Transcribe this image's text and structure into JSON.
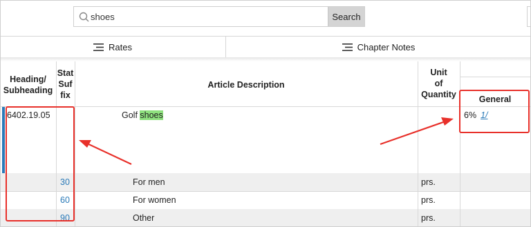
{
  "search": {
    "value": "shoes",
    "button_label": "Search"
  },
  "tabs": [
    {
      "label": "Rates",
      "icon": "menu-icon"
    },
    {
      "label": "Chapter Notes",
      "icon": "menu-icon"
    }
  ],
  "table": {
    "headers": {
      "heading_line1": "Heading/",
      "heading_line2": "Subheading",
      "stat_line1": "Stat",
      "stat_line2": "Suf",
      "stat_line3": "fix",
      "description": "Article Description",
      "unit_line1": "Unit",
      "unit_line2": "of",
      "unit_line3": "Quantity",
      "general": "General"
    },
    "rows": [
      {
        "heading": "6402.19.05",
        "suffix": "",
        "description_prefix": "Golf ",
        "description_highlight": "shoes",
        "unit": "",
        "general": "6%",
        "general_note": "1/"
      },
      {
        "heading": "",
        "suffix": "30",
        "description": "For men",
        "unit": "prs."
      },
      {
        "heading": "",
        "suffix": "60",
        "description": "For women",
        "unit": "prs."
      },
      {
        "heading": "",
        "suffix": "90",
        "description": "Other",
        "unit": "prs."
      }
    ]
  },
  "colors": {
    "accent": "#2a7ab8",
    "highlight": "#8ee07e",
    "annotation": "#e8302a"
  }
}
